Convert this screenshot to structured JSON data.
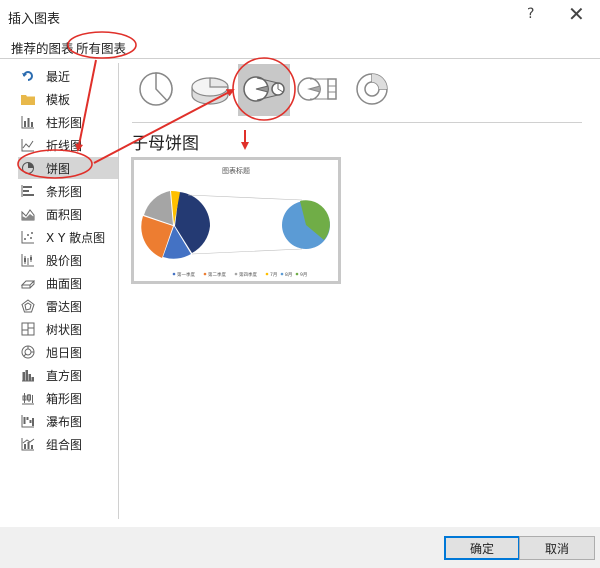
{
  "dialog": {
    "title": "插入图表",
    "help_label": "?",
    "close_label": "✕"
  },
  "tabs": [
    {
      "label": "推荐的图表",
      "selected": false
    },
    {
      "label": "所有图表",
      "selected": true
    }
  ],
  "sidebar": {
    "items": [
      {
        "label": "最近",
        "icon": "recent-icon"
      },
      {
        "label": "模板",
        "icon": "folder-icon"
      },
      {
        "label": "柱形图",
        "icon": "column-chart-icon"
      },
      {
        "label": "折线图",
        "icon": "line-chart-icon"
      },
      {
        "label": "饼图",
        "icon": "pie-chart-icon",
        "selected": true
      },
      {
        "label": "条形图",
        "icon": "bar-chart-icon"
      },
      {
        "label": "面积图",
        "icon": "area-chart-icon"
      },
      {
        "label": "X Y 散点图",
        "icon": "scatter-chart-icon"
      },
      {
        "label": "股价图",
        "icon": "stock-chart-icon"
      },
      {
        "label": "曲面图",
        "icon": "surface-chart-icon"
      },
      {
        "label": "雷达图",
        "icon": "radar-chart-icon"
      },
      {
        "label": "树状图",
        "icon": "treemap-chart-icon"
      },
      {
        "label": "旭日图",
        "icon": "sunburst-chart-icon"
      },
      {
        "label": "直方图",
        "icon": "histogram-chart-icon"
      },
      {
        "label": "箱形图",
        "icon": "box-whisker-chart-icon"
      },
      {
        "label": "瀑布图",
        "icon": "waterfall-chart-icon"
      },
      {
        "label": "组合图",
        "icon": "combo-chart-icon"
      }
    ]
  },
  "subtypes": [
    {
      "icon": "pie-subtype-icon",
      "selected": false
    },
    {
      "icon": "pie-3d-subtype-icon",
      "selected": false
    },
    {
      "icon": "pie-of-pie-subtype-icon",
      "selected": true
    },
    {
      "icon": "bar-of-pie-subtype-icon",
      "selected": false
    },
    {
      "icon": "doughnut-subtype-icon",
      "selected": false
    }
  ],
  "chart_type_title": "子母饼图",
  "preview": {
    "chart_title": "图表标题",
    "legend": [
      {
        "label": "第一季度",
        "color": "#4472c4"
      },
      {
        "label": "第二季度",
        "color": "#ed7d31"
      },
      {
        "label": "第四季度",
        "color": "#a5a5a5"
      },
      {
        "label": "7月",
        "color": "#ffc000"
      },
      {
        "label": "8月",
        "color": "#5b9bd5"
      },
      {
        "label": "9月",
        "color": "#70ad47"
      }
    ]
  },
  "buttons": {
    "ok": "确定",
    "cancel": "取消"
  },
  "annotation_color": "#e0302a"
}
